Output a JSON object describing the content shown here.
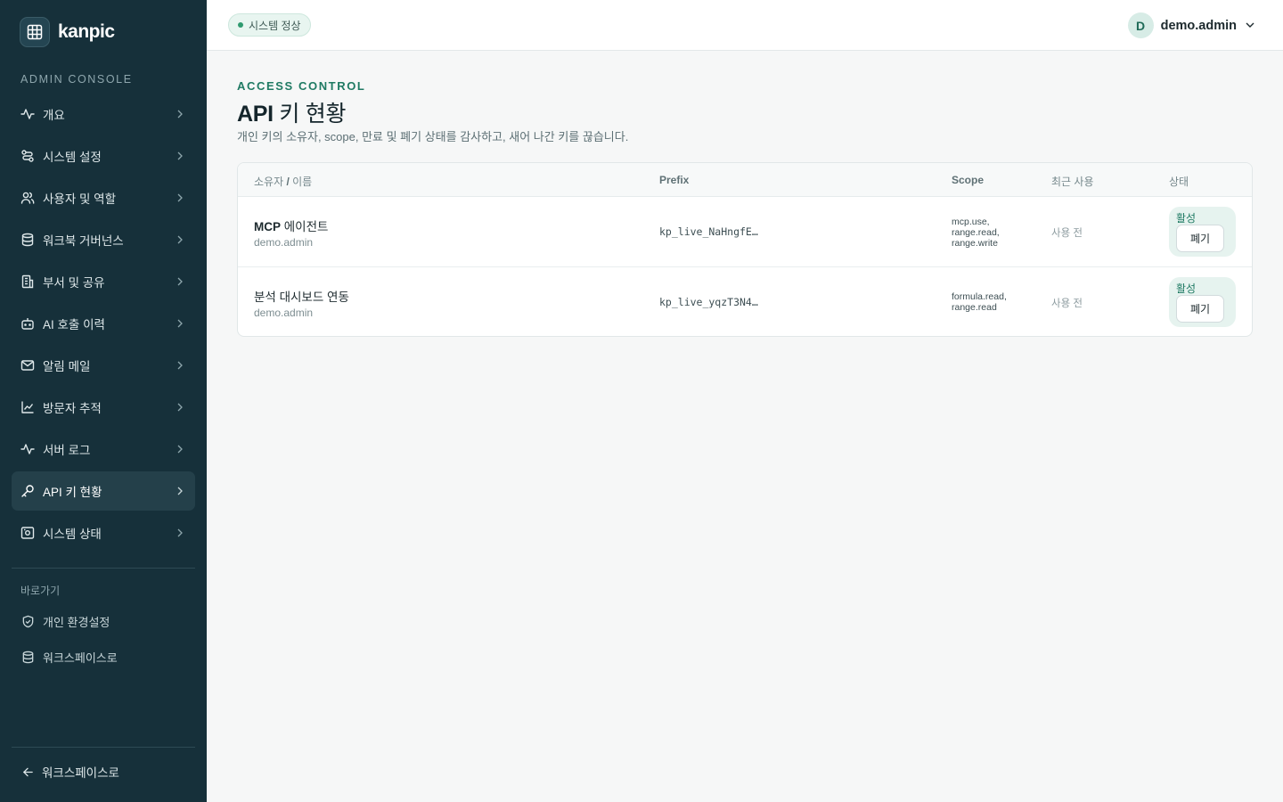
{
  "brand": {
    "name": "kanpic"
  },
  "sidebar": {
    "section_label": "ADMIN CONSOLE",
    "items": [
      {
        "label": "개요",
        "icon": "activity-icon"
      },
      {
        "label": "시스템 설정",
        "icon": "route-icon"
      },
      {
        "label": "사용자 및 역할",
        "icon": "users-icon"
      },
      {
        "label": "워크북 거버넌스",
        "icon": "database-icon"
      },
      {
        "label": "부서 및 공유",
        "icon": "building-icon"
      },
      {
        "label": "AI 호출 이력",
        "icon": "bot-icon"
      },
      {
        "label": "알림 메일",
        "icon": "mail-icon"
      },
      {
        "label": "방문자 추적",
        "icon": "line-chart-icon"
      },
      {
        "label": "서버 로그",
        "icon": "activity-icon"
      },
      {
        "label": "API 키 현황",
        "icon": "key-icon",
        "active": true
      },
      {
        "label": "시스템 상태",
        "icon": "server-icon"
      }
    ],
    "shortcuts_label": "바로가기",
    "shortcuts": [
      {
        "label": "개인 환경설정",
        "icon": "shield-icon"
      },
      {
        "label": "워크스페이스로",
        "icon": "database-icon"
      }
    ],
    "back_label": "워크스페이스로"
  },
  "topbar": {
    "status": "시스템 정상",
    "user": {
      "initial": "D",
      "name": "demo.admin"
    }
  },
  "page": {
    "eyebrow": "ACCESS CONTROL",
    "title_bold": "API",
    "title_rest": " 키 현황",
    "description": "개인 키의 소유자, scope, 만료 및 폐기 상태를 감사하고, 새어 나간 키를 끊습니다."
  },
  "table": {
    "headers": {
      "owner_pre": "소유자 ",
      "owner_sep": "/",
      "owner_post": " 이름",
      "prefix": "Prefix",
      "scope": "Scope",
      "last_used": "최근 사용",
      "status": "상태"
    },
    "rows": [
      {
        "name_bold": "MCP",
        "name_rest": " 에이전트",
        "owner": "demo.admin",
        "prefix": "kp_live_NaHngfE…",
        "scope": [
          "mcp.use,",
          "range.read,",
          "range.write"
        ],
        "last_used": "사용 전",
        "status": "활성",
        "action": "폐기"
      },
      {
        "name_bold": "",
        "name_rest": "분석 대시보드 연동",
        "owner": "demo.admin",
        "prefix": "kp_live_yqzT3N4…",
        "scope": [
          "formula.read,",
          "range.read"
        ],
        "last_used": "사용 전",
        "status": "활성",
        "action": "폐기"
      }
    ]
  },
  "colors": {
    "sidebar_bg": "#16303a",
    "accent": "#1f7a63",
    "status_green": "#2f9a6f"
  }
}
